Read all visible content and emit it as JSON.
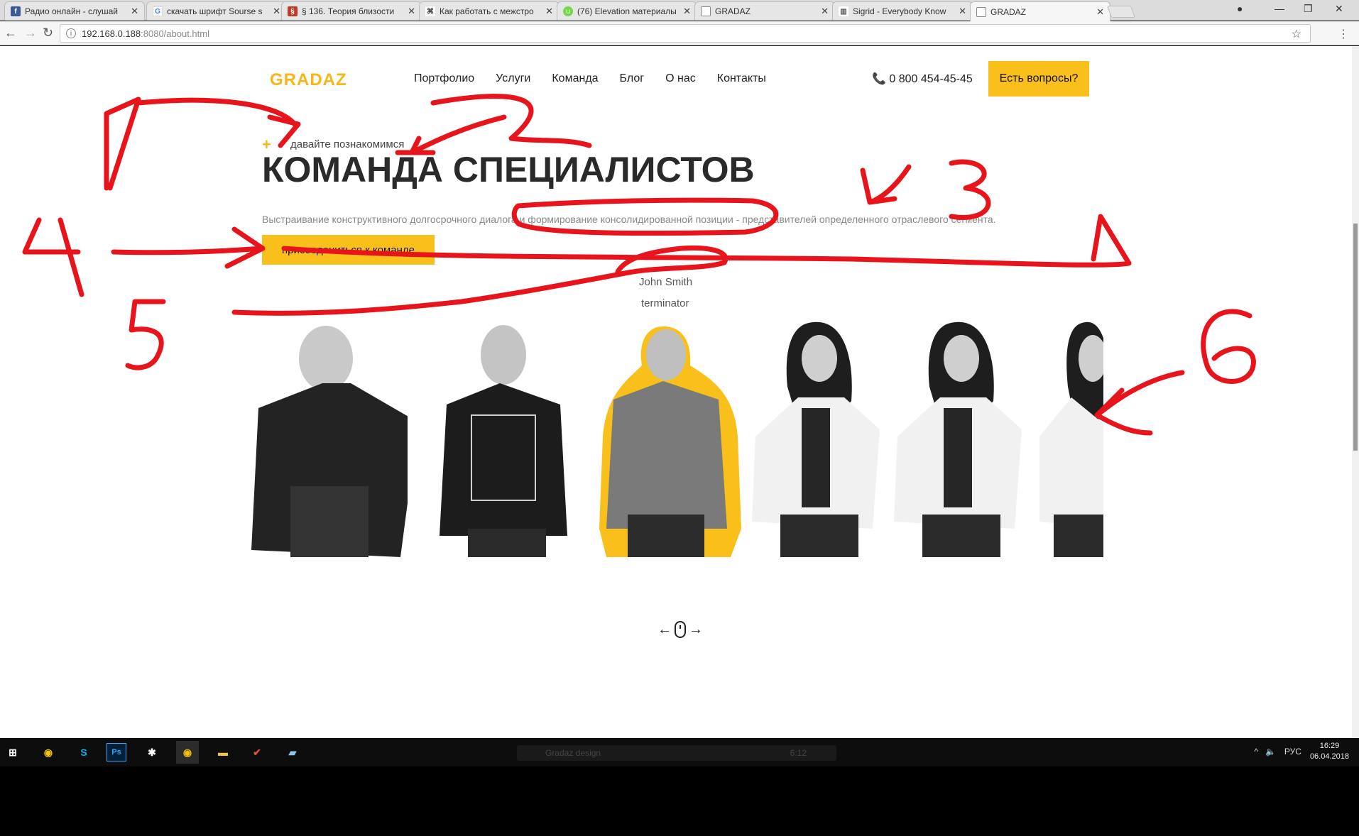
{
  "browser": {
    "tabs": [
      {
        "title": "Радио онлайн - слушай",
        "icon": "facebook-icon",
        "color": "#3b5998"
      },
      {
        "title": "скачать шрифт Sourse s",
        "icon": "google-icon",
        "color": "#4285f4"
      },
      {
        "title": "§ 136. Теория близости",
        "icon": "book-icon",
        "color": "#c0392b"
      },
      {
        "title": "Как работать с межстро",
        "icon": "command-icon",
        "color": "#333333"
      },
      {
        "title": "(76) Elevation материалы",
        "icon": "upwork-icon",
        "color": "#6fda44"
      },
      {
        "title": "GRADAZ",
        "icon": "page-icon",
        "color": "#888888"
      },
      {
        "title": "Sigrid - Everybody Know",
        "icon": "chart-icon",
        "color": "#555555"
      },
      {
        "title": "GRADAZ",
        "icon": "page-icon",
        "color": "#888888",
        "active": true
      }
    ],
    "url_host": "192.168.0.188",
    "url_rest": ":8080/about.html"
  },
  "site": {
    "logo": "GRADAZ",
    "nav": [
      "Портфолио",
      "Услуги",
      "Команда",
      "Блог",
      "О нас",
      "Контакты"
    ],
    "phone": "0 800 454-45-45",
    "cta": "Есть вопросы?",
    "eyebrow": "давайте познакомимся",
    "title": "КОМАНДА СПЕЦИАЛИСТОВ",
    "description": "Выстраивание конструктивного долгосрочного диалога и формирование консолидированной позиции - представителей определенного отраслевого сегмента.",
    "join_button": "присоедениться к команде",
    "person_name": "John Smith",
    "person_role": "terminator",
    "accent": "#f9c01c"
  },
  "annotations": [
    "1",
    "2",
    "3",
    "4",
    "5",
    "6"
  ],
  "taskbar": {
    "media_title": "Gradaz design",
    "media_time": "6:12",
    "lang": "РУС",
    "time": "16:29",
    "date": "06.04.2018"
  }
}
